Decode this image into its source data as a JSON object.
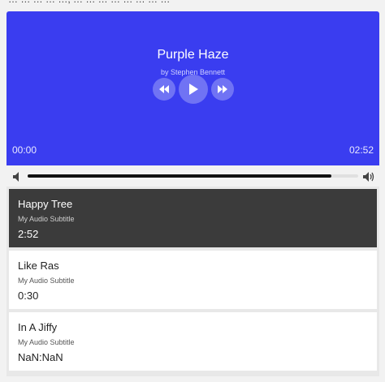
{
  "header": {
    "cut_text": "… … … … …, … … … … … … … …"
  },
  "player": {
    "title": "Purple Haze",
    "artist": "by Stephen Bennett",
    "current_time": "00:00",
    "total_time": "02:52",
    "progress": 0.92,
    "accent_color": "#3a3df0"
  },
  "playlist": [
    {
      "title": "Happy Tree",
      "subtitle": "My Audio Subtitle",
      "duration": "2:52",
      "active": true
    },
    {
      "title": "Like Ras",
      "subtitle": "My Audio Subtitle",
      "duration": "0:30",
      "active": false
    },
    {
      "title": "In A Jiffy",
      "subtitle": "My Audio Subtitle",
      "duration": "NaN:NaN",
      "active": false
    }
  ],
  "icons": {
    "rewind": "rewind-icon",
    "play": "play-icon",
    "fast_forward": "fast-forward-icon",
    "volume_low": "volume-low-icon",
    "volume_high": "volume-high-icon"
  }
}
